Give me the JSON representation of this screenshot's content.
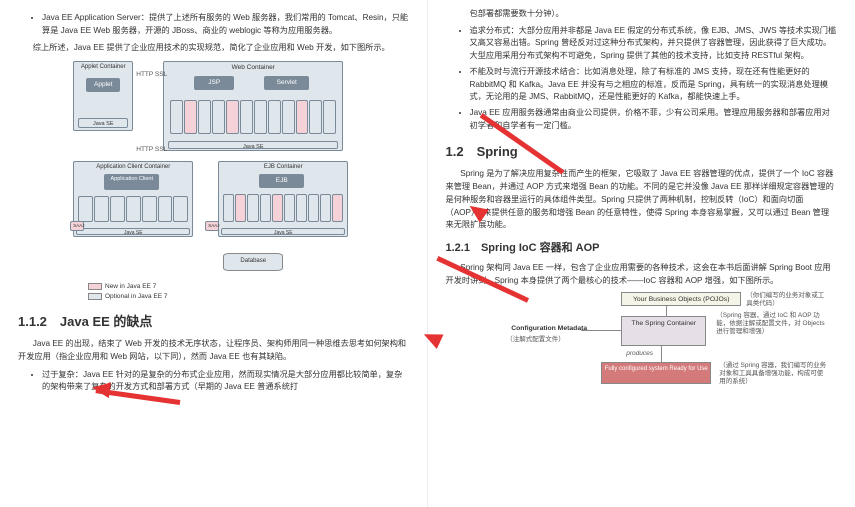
{
  "left": {
    "bullet_javaee_server": "Java EE Application Server：提供了上述所有服务的 Web 服务器，我们常用的 Tomcat、Resin，只能算是 Java EE Web 服务器，开源的 JBoss、商业的 weblogic 等称为应用服务器。",
    "summary": "综上所述，Java EE 提供了企业应用技术的实现规范，简化了企业应用和 Web 开发，如下图所示。",
    "diagram": {
      "applet_container": "Applet Container",
      "applet": "Applet",
      "java_se": "Java SE",
      "web_container": "Web Container",
      "jsp": "JSP",
      "servlet": "Servlet",
      "app_client_container": "Application Client Container",
      "app_client": "Application Client",
      "ejb_container": "EJB Container",
      "ejb": "EJB",
      "database": "Database",
      "http_ssl": "HTTP SSL",
      "saaj": "SAAJ",
      "legend_new": "New in Java EE 7",
      "legend_opt": "Optional in Java EE 7"
    },
    "section_112": "1.1.2　Java EE 的缺点",
    "para_112": "Java EE 的出现，结束了 Web 开发的技术无序状态，让程序员、架构师用同一种思维去思考如何架构和开发应用（指企业应用和 Web 网站，以下同），然而 Java EE 也有其缺陷。",
    "bullet_112": "过于复杂：Java EE 针对的是复杂的分布式企业应用，然而现实情况是大部分应用都比较简单，复杂的架构带来了复杂的开发方式和部署方式（早期的 Java EE 普通系统打"
  },
  "right": {
    "top_frag": "包部署都需要数十分钟）。",
    "bullets": [
      "追求分布式：大部分应用并非都是 Java EE 假定的分布式系统，像 EJB、JMS、JWS 等技术实现门槛又高又容易出错。Spring 曾经反对过这种分布式架构，并只提供了容器管理，因此获得了巨大成功。大型应用采用分布式架构不可避免，Spring 提供了其他的技术支持，比如支持 RESTful 架构。",
      "不能及时与流行开源技术结合：比如消息处理，除了有标准的 JMS 支持，现在还有性能更好的 RabbitMQ 和 Kafka。Java EE 并没有与之相应的标准，反而是 Spring，具有统一的实现消息处理模式，无论用的是 JMS、RabbitMQ，还是性能更好的 Kafka，都能快速上手。",
      "Java EE 应用服务器通常由商业公司提供，价格不菲，少有公司采用。管理应用服务器和部署应用对初学者和自学者有一定门槛。"
    ],
    "section_12": "1.2　Spring",
    "para_12": "Spring 是为了解决应用复杂性而产生的框架，它吸取了 Java EE 容器管理的优点，提供了一个 IoC 容器来管理 Bean，并通过 AOP 方式来增强 Bean 的功能。不同的是它并没像 Java EE 那样详细规定容器管理的是何种服务和容器里运行的具体组件类型。Spring 只提供了两种机制，控制反转（IoC）和面向切面（AOP），来提供任意的服务和增强 Bean 的任意特性，使得 Spring 本身容易掌握，又可以通过 Bean 管理来无限扩展功能。",
    "section_121": "1.2.1　Spring IoC 容器和 AOP",
    "para_121": "Spring 架构同 Java EE 一样，包含了企业应用需要的各种技术，这会在本书后面讲解 Spring Boot 应用开发时讲到。Spring 本身提供了两个最核心的技术——IoC 容器和 AOP 增强，如下图所示。",
    "spring_diagram": {
      "pojos": "Your Business Objects (POJOs)",
      "pojos_note": "（你们编写的业务对象或工具类代码）",
      "config": "Configuration Metadata",
      "config_note": "（注解式配置文件）",
      "container": "The Spring Container",
      "container_note": "（Spring 容器，通过 IoC 和 AOP 功能，依据注解或配置文件，对 Objects 进行管理和增强）",
      "produces": "produces",
      "ready": "Fully configured system Ready for Use",
      "ready_note": "（通过 Spring 容器，我们编写的业务对象和工具具备增强功能，构成可使用的系统）"
    }
  }
}
